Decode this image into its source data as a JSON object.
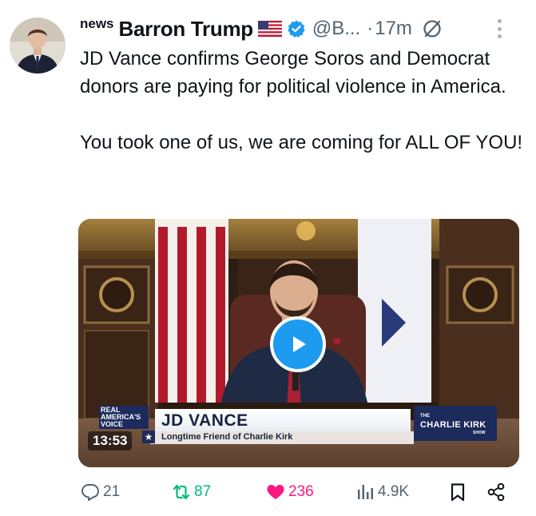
{
  "author": {
    "prefix": "news",
    "name": "Barron Trump",
    "flag_emoji": "us-flag-icon",
    "handle": "@B...",
    "separator": "·",
    "timestamp": "17m"
  },
  "tweet": {
    "paragraphs": [
      "JD Vance confirms George Soros and Democrat donors are paying for political violence in America.",
      "You took one of us, we are coming for ALL OF YOU!"
    ]
  },
  "media": {
    "duration": "13:53",
    "lower_third": {
      "logo_line1": "REAL",
      "logo_line2": "AMERICA'S",
      "logo_line3": "VOICE",
      "name": "JD VANCE",
      "subtitle": "Longtime Friend of Charlie Kirk",
      "star": "★",
      "show_the": "THE",
      "show_name": "CHARLIE KIRK",
      "show_sub": "SHOW"
    }
  },
  "actions": {
    "replies": "21",
    "reposts": "87",
    "likes": "236",
    "views": "4.9K"
  },
  "colors": {
    "text": "#0f1419",
    "muted": "#536471",
    "accent": "#1d9bf0",
    "repost": "#00ba7c",
    "like": "#f91880"
  }
}
